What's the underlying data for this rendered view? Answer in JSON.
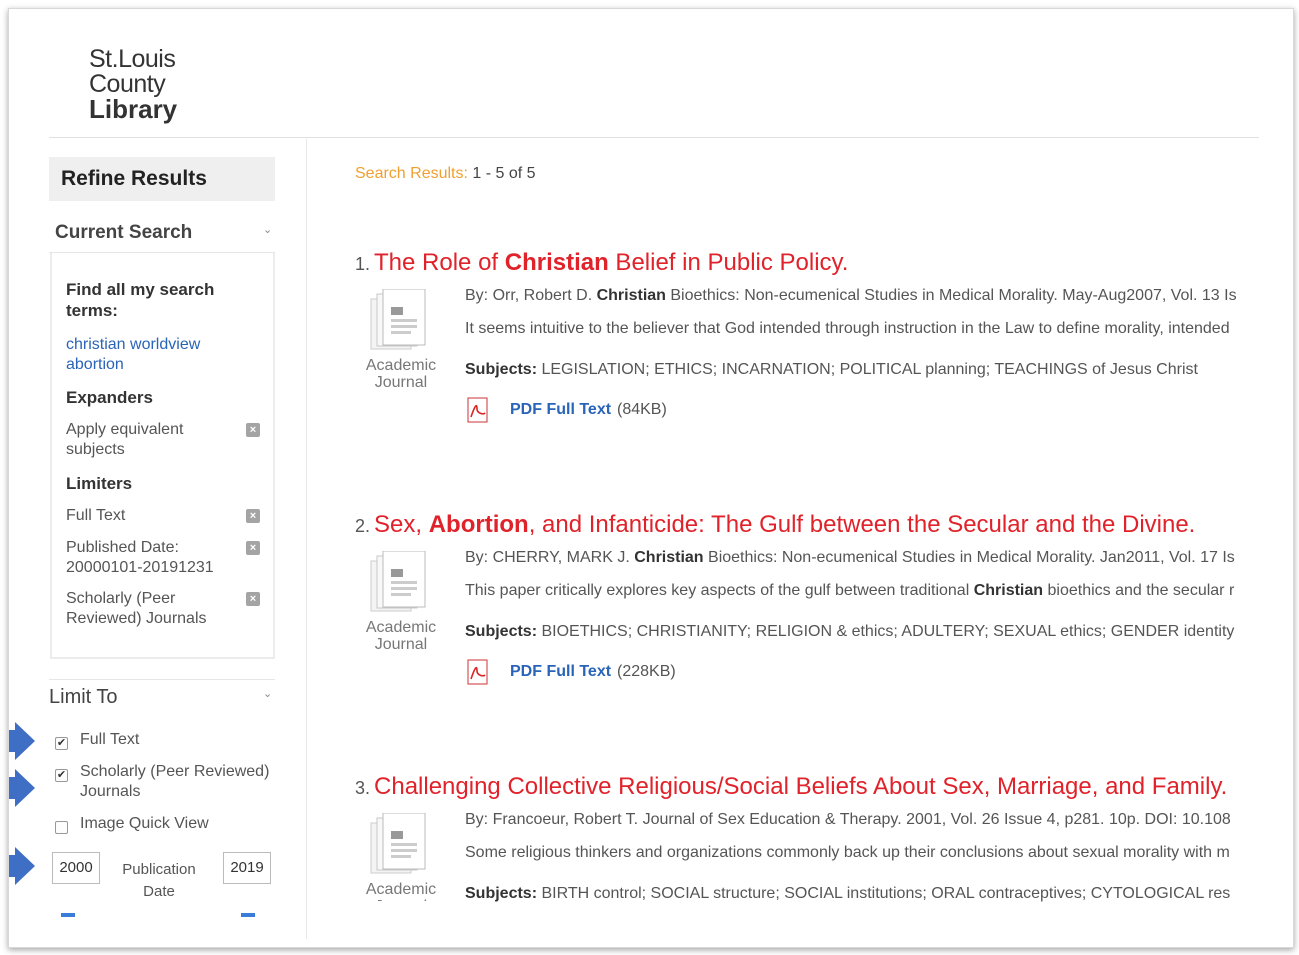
{
  "logo": {
    "line1": "St.Louis",
    "line2": "County",
    "line3": "Library"
  },
  "sidebar": {
    "refine_title": "Refine Results",
    "current_search": {
      "heading": "Current Search",
      "find_all_label": "Find all my search terms:",
      "terms": [
        "christian worldview",
        "abortion"
      ],
      "expanders_label": "Expanders",
      "expanders": [
        "Apply equivalent subjects"
      ],
      "limiters_label": "Limiters",
      "limiters": [
        "Full Text",
        "Published Date: 20000101-20191231",
        "Scholarly (Peer Reviewed) Journals"
      ]
    },
    "limit_to": {
      "heading": "Limit To",
      "options": [
        {
          "label": "Full Text",
          "checked": true
        },
        {
          "label": "Scholarly (Peer Reviewed) Journals",
          "checked": true
        },
        {
          "label": "Image Quick View",
          "checked": false
        }
      ],
      "date_from": "2000",
      "date_to": "2019",
      "date_label": "Publication Date"
    }
  },
  "results": {
    "count_label": "Search Results:",
    "count_value": "1 - 5 of 5",
    "items": [
      {
        "num": "1.",
        "title_parts": [
          "The Role of ",
          "Christian",
          " Belief in Public Policy."
        ],
        "doc_type": "Academic Journal",
        "by_prefix": "By: Orr, Robert D. ",
        "by_bold": "Christian",
        "by_rest": " Bioethics: Non-ecumenical Studies in Medical Morality. May-Aug2007, Vol. 13 Is",
        "abstract": "It seems intuitive to the believer that God intended through instruction in the Law to define morality, intended",
        "abstract_bold": "",
        "abstract_rest": "",
        "subjects_label": "Subjects:",
        "subjects": "LEGISLATION; ETHICS; INCARNATION; POLITICAL planning; TEACHINGS of Jesus Christ",
        "pdf_label": "PDF Full Text",
        "pdf_size": "(84KB)"
      },
      {
        "num": "2.",
        "title_parts": [
          "Sex, ",
          "Abortion",
          ", and Infanticide: The Gulf between the Secular and the Divine."
        ],
        "doc_type": "Academic Journal",
        "by_prefix": "By: CHERRY, MARK J. ",
        "by_bold": "Christian",
        "by_rest": " Bioethics: Non-ecumenical Studies in Medical Morality. Jan2011, Vol. 17 Is",
        "abstract": "This paper critically explores key aspects of the gulf between traditional ",
        "abstract_bold": "Christian",
        "abstract_rest": " bioethics and the secular r",
        "subjects_label": "Subjects:",
        "subjects": "BIOETHICS; CHRISTIANITY; RELIGION & ethics; ADULTERY; SEXUAL ethics; GENDER identity",
        "pdf_label": "PDF Full Text",
        "pdf_size": "(228KB)"
      },
      {
        "num": "3.",
        "title_parts": [
          "Challenging Collective Religious/Social Beliefs About Sex, Marriage, and Family.",
          "",
          ""
        ],
        "doc_type": "Academic Journal",
        "by_prefix": "By: Francoeur, Robert T. Journal of Sex Education & Therapy. 2001, Vol. 26 Issue 4, p281. 10p. DOI: 10.108",
        "by_bold": "",
        "by_rest": "",
        "abstract": "Some religious thinkers and organizations commonly back up their conclusions about sexual morality with m",
        "abstract_bold": "",
        "abstract_rest": "",
        "subjects_label": "Subjects:",
        "subjects": "BIRTH control; SOCIAL structure; SOCIAL institutions; ORAL contraceptives; CYTOLOGICAL res",
        "pdf_label": "",
        "pdf_size": ""
      }
    ]
  },
  "colors": {
    "title_red": "#e0222a",
    "link_blue": "#2a64b8",
    "label_orange": "#f0a030",
    "arrow_blue": "#3f6fc4"
  }
}
